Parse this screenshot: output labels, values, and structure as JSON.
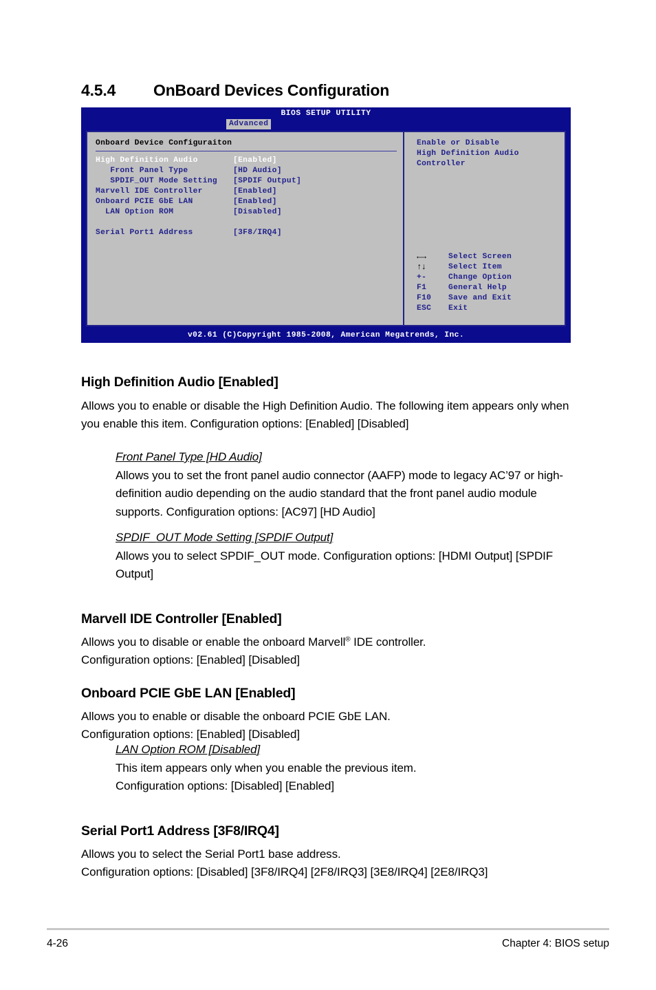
{
  "section": {
    "number": "4.5.4",
    "title": "OnBoard Devices Configuration"
  },
  "bios": {
    "title": "BIOS SETUP UTILITY",
    "tab": "Advanced",
    "panel_title": "Onboard Device Configuraiton",
    "items": [
      {
        "label": "High Definition Audio",
        "value": "[Enabled]",
        "selected": true
      },
      {
        "label": "   Front Panel Type",
        "value": "[HD Audio]",
        "selected": false
      },
      {
        "label": "   SPDIF_OUT Mode Setting",
        "value": "[SPDIF Output]",
        "selected": false
      },
      {
        "label": "Marvell IDE Controller",
        "value": "[Enabled]",
        "selected": false
      },
      {
        "label": "Onboard PCIE GbE LAN",
        "value": "[Enabled]",
        "selected": false
      },
      {
        "label": "  LAN Option ROM",
        "value": "[Disabled]",
        "selected": false
      },
      {
        "label": "",
        "value": "",
        "selected": false
      },
      {
        "label": "Serial Port1 Address",
        "value": "[3F8/IRQ4]",
        "selected": false
      }
    ],
    "help": [
      "Enable or Disable",
      "High Definition Audio",
      "Controller"
    ],
    "nav": [
      {
        "key": "←→",
        "glyph": true,
        "text": "Select Screen"
      },
      {
        "key": "↑↓",
        "glyph": true,
        "text": "Select Item"
      },
      {
        "key": "+-",
        "glyph": false,
        "text": "Change Option"
      },
      {
        "key": "F1",
        "glyph": false,
        "text": "General Help"
      },
      {
        "key": "F10",
        "glyph": false,
        "text": "Save and Exit"
      },
      {
        "key": "ESC",
        "glyph": false,
        "text": "Exit"
      }
    ],
    "footer": "v02.61 (C)Copyright 1985-2008, American Megatrends, Inc.",
    "colors": {
      "chrome_blue": "#0b0b8e",
      "panel_gray": "#c0c0c0",
      "text_blue": "#22228c",
      "selected_white": "#ffffff"
    }
  },
  "body": {
    "s1": {
      "heading": "High Definition Audio [Enabled]",
      "para": "Allows you to enable or disable the High Definition Audio. The following item appears only when you enable this item. Configuration options: [Enabled] [Disabled]"
    },
    "s1a": {
      "heading": "Front Panel Type [HD Audio]",
      "para": "Allows you to set the front panel audio connector (AAFP) mode to legacy AC’97 or high-definition audio depending on the audio standard that the front panel audio module supports. Configuration options: [AC97] [HD Audio]"
    },
    "s1b": {
      "heading": "SPDIF_OUT Mode Setting [SPDIF Output]",
      "para": "Allows you to select SPDIF_OUT mode. Configuration options: [HDMI Output] [SPDIF Output]"
    },
    "s2": {
      "heading": "Marvell IDE Controller [Enabled]",
      "para_a": "Allows you to disable or enable the onboard Marvell",
      "para_sup": "®",
      "para_b": " IDE controller.",
      "para_c": "Configuration options: [Enabled] [Disabled]"
    },
    "s3": {
      "heading": "Onboard PCIE GbE LAN [Enabled]",
      "para_a": "Allows you to enable or disable the onboard PCIE GbE LAN.",
      "para_b": "Configuration options: [Enabled] [Disabled]"
    },
    "s3a": {
      "heading": "LAN Option ROM [Disabled]",
      "para_a": "This item appears only when you enable the previous item.",
      "para_b": "Configuration options: [Disabled] [Enabled]"
    },
    "s4": {
      "heading": "Serial Port1 Address [3F8/IRQ4]",
      "para_a": "Allows you to select the Serial Port1 base address.",
      "para_b": "Configuration options: [Disabled] [3F8/IRQ4] [2F8/IRQ3] [3E8/IRQ4] [2E8/IRQ3]"
    }
  },
  "footer": {
    "page": "4-26",
    "chapter": "Chapter 4: BIOS setup"
  }
}
